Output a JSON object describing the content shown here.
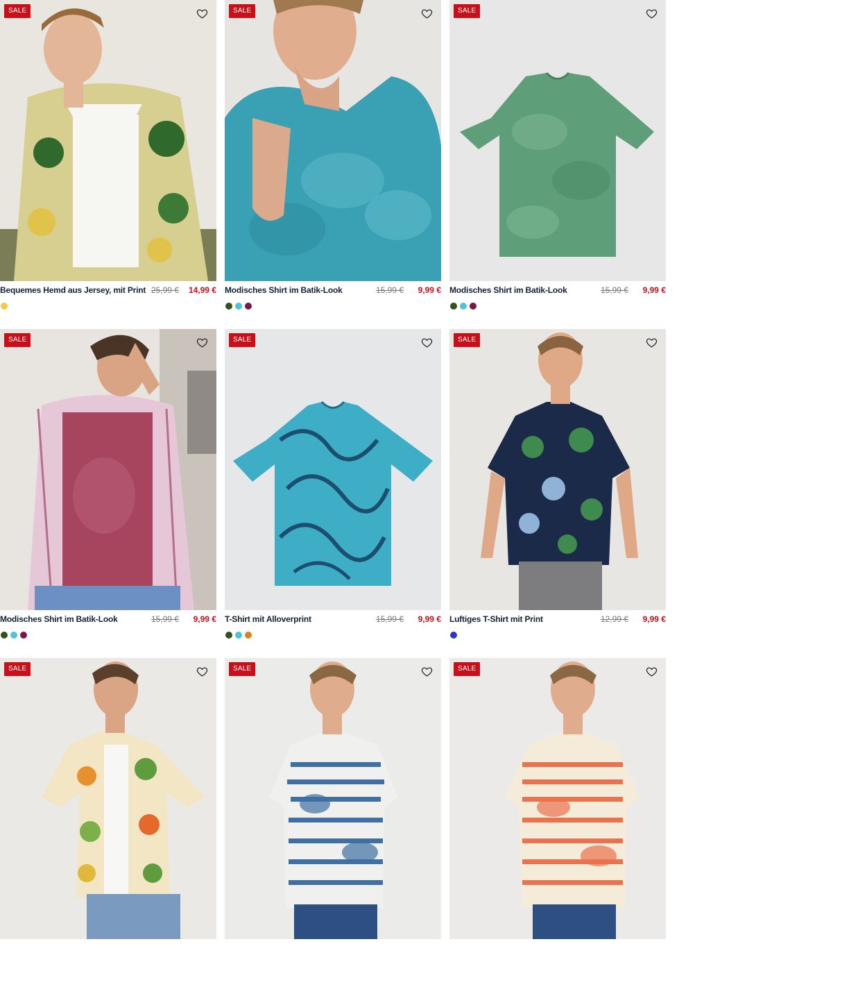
{
  "products": [
    {
      "badge": "SALE",
      "title": "Bequemes Hemd aus Jersey, mit Print",
      "old_price": "25,99 €",
      "price": "14,99 €",
      "colors": [
        "#f5c842"
      ],
      "image": "model-tropical-shirt"
    },
    {
      "badge": "SALE",
      "title": "Modisches Shirt im Batik-Look",
      "old_price": "15,99 €",
      "price": "9,99 €",
      "colors": [
        "#33511a",
        "#4ec4d8",
        "#7a1747"
      ],
      "image": "model-tie-dye-teal-shirt"
    },
    {
      "badge": "SALE",
      "title": "Modisches Shirt im Batik-Look",
      "old_price": "15,99 €",
      "price": "9,99 €",
      "colors": [
        "#33511a",
        "#4ec4d8",
        "#7a1747"
      ],
      "image": "green-tie-dye-tshirt"
    },
    {
      "badge": "SALE",
      "title": "Modisches Shirt im Batik-Look",
      "old_price": "15,99 €",
      "price": "9,99 €",
      "colors": [
        "#33511a",
        "#4ec4d8",
        "#7a1747"
      ],
      "image": "model-plaid-over-red-shirt"
    },
    {
      "badge": "SALE",
      "title": "T-Shirt mit Alloverprint",
      "old_price": "15,99 €",
      "price": "9,99 €",
      "colors": [
        "#33511a",
        "#4ec4d8",
        "#e07d25"
      ],
      "image": "blue-allover-print-tshirt"
    },
    {
      "badge": "SALE",
      "title": "Luftiges T-Shirt mit Print",
      "old_price": "12,99 €",
      "price": "9,99 €",
      "colors": [
        "#2d35c9"
      ],
      "image": "model-navy-leaf-tshirt"
    },
    {
      "badge": "SALE",
      "title": "",
      "old_price": "",
      "price": "",
      "colors": [],
      "image": "model-floral-shirt"
    },
    {
      "badge": "SALE",
      "title": "",
      "old_price": "",
      "price": "",
      "colors": [],
      "image": "model-blue-stripe-tshirt"
    },
    {
      "badge": "SALE",
      "title": "",
      "old_price": "",
      "price": "",
      "colors": [],
      "image": "model-orange-stripe-tshirt"
    }
  ],
  "icons": {
    "wishlist": "heart-outline-icon"
  }
}
